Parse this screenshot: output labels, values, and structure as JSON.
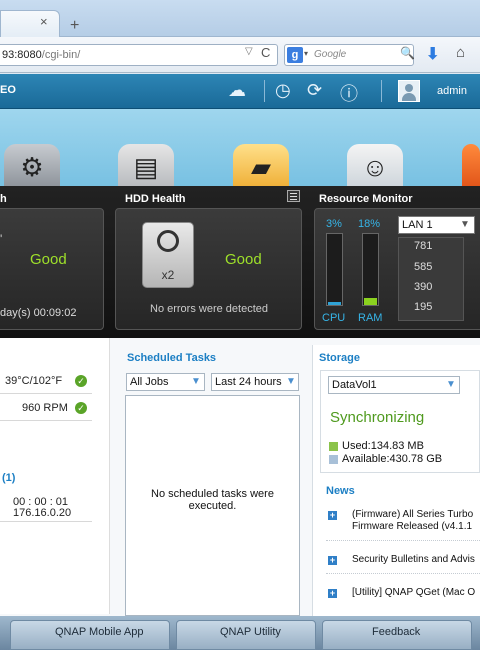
{
  "browser": {
    "url_host": "93:8080",
    "url_path": "/cgi-bin/",
    "search_engine": "g",
    "search_placeholder": "Google",
    "tab_close": "×",
    "new_tab": "+"
  },
  "header": {
    "brand": "EO",
    "user": "admin"
  },
  "dashboard": {
    "system_health": {
      "title": "h",
      "status": "Good",
      "uptime": "day(s) 00:09:02"
    },
    "hdd_health": {
      "title": "HDD Health",
      "status": "Good",
      "disk_count": "x2",
      "message": "No errors were detected"
    },
    "resource_monitor": {
      "title": "Resource Monitor",
      "cpu_label": "CPU",
      "ram_label": "RAM",
      "cpu_percent_text": "3%",
      "ram_percent_text": "18%",
      "cpu_level": 0.03,
      "ram_level": 0.18,
      "lan_select": "LAN 1",
      "lan_ticks": [
        "781",
        "585",
        "390",
        "195"
      ]
    }
  },
  "hardware": {
    "temperature": "39°C/102°F",
    "fan_speed": "960 RPM",
    "users_title": "(1)",
    "session_time": "00 : 00 : 01",
    "session_ip": "176.16.0.20"
  },
  "scheduled_tasks": {
    "title": "Scheduled Tasks",
    "filter_type": "All Jobs",
    "filter_range": "Last 24 hours",
    "empty_message_line1": "No scheduled tasks were",
    "empty_message_line2": "executed."
  },
  "storage": {
    "title": "Storage",
    "volume": "DataVol1",
    "status": "Synchronizing",
    "used": "Used:134.83 MB",
    "available": "Available:430.78 GB",
    "used_color": "#8bc34a",
    "available_color": "#a8c0d8"
  },
  "news": {
    "title": "News",
    "items": [
      {
        "line1": "(Firmware) All Series Turbo",
        "line2": "Firmware Released (v4.1.1"
      },
      {
        "line1": "Security Bulletins and Advis",
        "line2": ""
      },
      {
        "line1": "[Utility] QNAP QGet (Mac O",
        "line2": ""
      }
    ]
  },
  "bottom_bar": {
    "items": [
      "QNAP Mobile App",
      "QNAP Utility",
      "Feedback"
    ]
  },
  "icons": {
    "cloud": "cloud-icon",
    "clock": "clock-icon",
    "sync": "sync-icon",
    "info": "info-icon"
  },
  "colors": {
    "accent": "#1c7fc4",
    "good": "#9ee02a",
    "header": "#1a6a98"
  }
}
